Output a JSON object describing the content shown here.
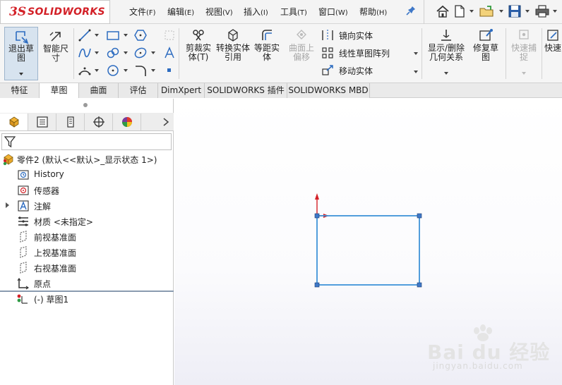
{
  "app": {
    "logo_prefix": "3S",
    "logo_text": "SOLIDWORKS"
  },
  "menu": [
    {
      "label": "文件",
      "key": "(F)"
    },
    {
      "label": "编辑",
      "key": "(E)"
    },
    {
      "label": "视图",
      "key": "(V)"
    },
    {
      "label": "插入",
      "key": "(I)"
    },
    {
      "label": "工具",
      "key": "(T)"
    },
    {
      "label": "窗口",
      "key": "(W)"
    },
    {
      "label": "帮助",
      "key": "(H)"
    }
  ],
  "ribbon": {
    "exit_sketch": "退出草图",
    "smart_dimension": "智能尺寸",
    "trim_entities": "剪裁实体(T)",
    "convert_entities": "转换实体引用",
    "offset_entities": "等距实体",
    "surface_offset": "曲面上偏移",
    "mirror_entities": "镜向实体",
    "linear_pattern": "线性草图阵列",
    "move_entities": "移动实体",
    "display_relations": "显示/删除几何关系",
    "repair_sketch": "修复草图",
    "quick_snaps": "快速捕捉",
    "rapid_sketch": "快速"
  },
  "command_tabs": [
    "特征",
    "草图",
    "曲面",
    "评估",
    "DimXpert",
    "SOLIDWORKS 插件",
    "SOLIDWORKS MBD"
  ],
  "active_tab": "草图",
  "tree": {
    "root": "零件2  (默认<<默认>_显示状态 1>)",
    "items": [
      {
        "label": "History",
        "icon": "history-icon"
      },
      {
        "label": "传感器",
        "icon": "sensor-icon"
      },
      {
        "label": "注解",
        "icon": "annotation-icon"
      },
      {
        "label": "材质 <未指定>",
        "icon": "material-icon"
      },
      {
        "label": "前视基准面",
        "icon": "plane-icon"
      },
      {
        "label": "上视基准面",
        "icon": "plane-icon"
      },
      {
        "label": "右视基准面",
        "icon": "plane-icon"
      },
      {
        "label": "原点",
        "icon": "origin-icon"
      }
    ],
    "sketch": "(-) 草图1"
  },
  "watermark": {
    "brand": "Bai du 经验",
    "url": "jingyan.baidu.com"
  },
  "colors": {
    "brand_red": "#d32027",
    "sketch_blue": "#3f94d8",
    "active_tab_bg": "#ffffff"
  }
}
